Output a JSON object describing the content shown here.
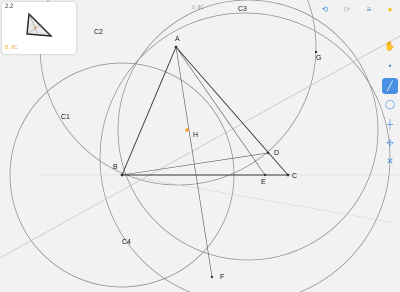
{
  "level": {
    "thumbnail_label": "2.2",
    "thumbnail_commands": "B, 8C"
  },
  "status": {
    "commands": "0, 8C"
  },
  "labels": {
    "A": "A",
    "B": "B",
    "C": "C",
    "D": "D",
    "E": "E",
    "F": "F",
    "G": "G",
    "H": "H",
    "C1": "C1",
    "C2": "C2",
    "C3": "C3",
    "C4": "C4"
  },
  "top_icons": [
    {
      "name": "undo-icon",
      "glyph": "⟲"
    },
    {
      "name": "redo-icon",
      "glyph": "⟳"
    },
    {
      "name": "menu-icon",
      "glyph": "≡"
    },
    {
      "name": "hint-bulb-icon",
      "glyph": "●"
    }
  ],
  "tools": [
    {
      "name": "move-tool-icon",
      "glyph": "✋",
      "active": false
    },
    {
      "name": "point-tool-icon",
      "glyph": "•",
      "active": false
    },
    {
      "name": "line-tool-icon",
      "glyph": "╱",
      "active": true
    },
    {
      "name": "circle-tool-icon",
      "glyph": "◯",
      "active": false
    },
    {
      "name": "perpendicular-tool-icon",
      "glyph": "┼",
      "active": false
    },
    {
      "name": "bisector-tool-icon",
      "glyph": "✢",
      "active": false
    },
    {
      "name": "intersect-tool-icon",
      "glyph": "✕",
      "active": false
    }
  ],
  "colors": {
    "background": "#f2f2f2",
    "accent": "#4a90e2",
    "highlight_point": "#f2a33a",
    "hint_bulb": "#f5c518"
  }
}
